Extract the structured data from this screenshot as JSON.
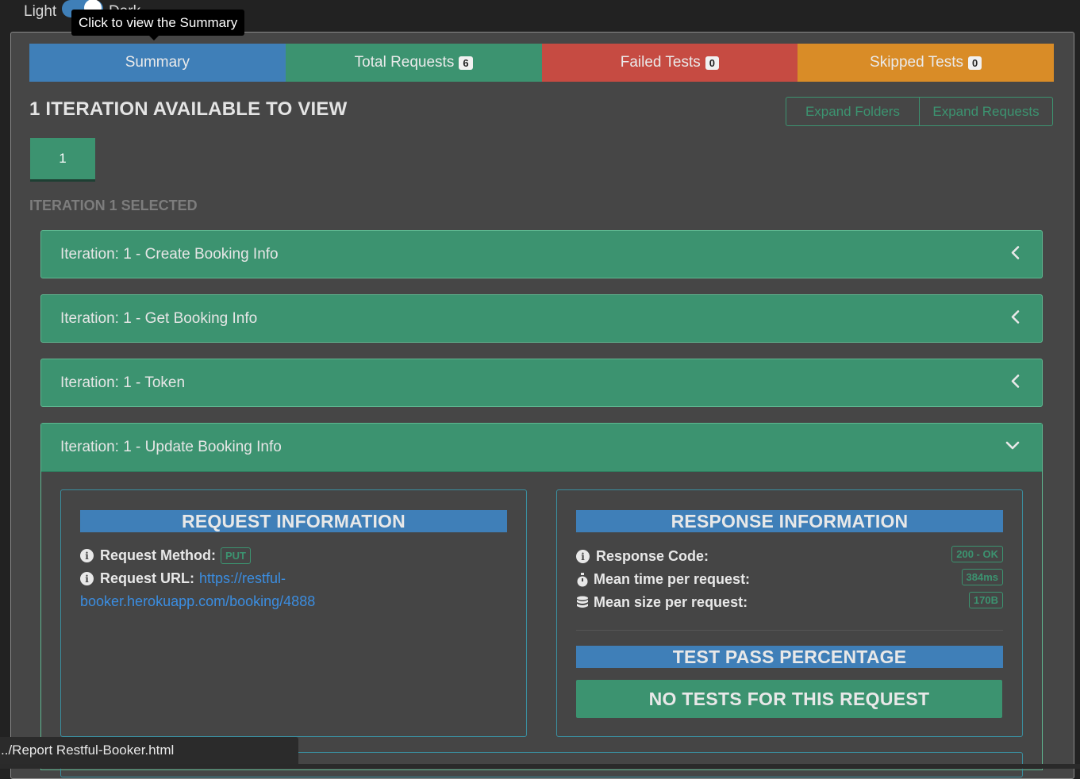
{
  "theme": {
    "light_label": "Light",
    "dark_label": "Dark"
  },
  "tooltip": "Click to view the Summary",
  "tabs": [
    {
      "label": "Summary"
    },
    {
      "label": "Total Requests",
      "badge": "6"
    },
    {
      "label": "Failed Tests",
      "badge": "0"
    },
    {
      "label": "Skipped Tests",
      "badge": "0"
    }
  ],
  "iterations": {
    "heading": "1 ITERATION AVAILABLE TO VIEW",
    "expand_folders": "Expand Folders",
    "expand_requests": "Expand Requests",
    "buttons": [
      "1"
    ],
    "selected_label": "ITERATION 1 SELECTED"
  },
  "panels": [
    {
      "title": "Iteration: 1 - Create Booking Info"
    },
    {
      "title": "Iteration: 1 - Get Booking Info"
    },
    {
      "title": "Iteration: 1 - Token"
    },
    {
      "title": "Iteration: 1 - Update Booking Info"
    }
  ],
  "request": {
    "title": "REQUEST INFORMATION",
    "method_label": "Request Method:",
    "method_value": "PUT",
    "url_label": "Request URL:",
    "url_value_line1": "https://restful-",
    "url_value_line2": "booker.herokuapp.com/booking/4888"
  },
  "response": {
    "title": "RESPONSE INFORMATION",
    "code_label": "Response Code:",
    "code_value": "200 - OK",
    "time_label": "Mean time per request:",
    "time_value": "384ms",
    "size_label": "Mean size per request:",
    "size_value": "170B",
    "test_title": "TEST PASS PERCENTAGE",
    "no_tests": "NO TESTS FOR THIS REQUEST"
  },
  "status_bar": "../Report Restful-Booker.html",
  "colors": {
    "summary": "#3f7fb8",
    "success": "#3c9370",
    "failed": "#c64b42",
    "skipped": "#d98c27",
    "background": "#464646"
  }
}
